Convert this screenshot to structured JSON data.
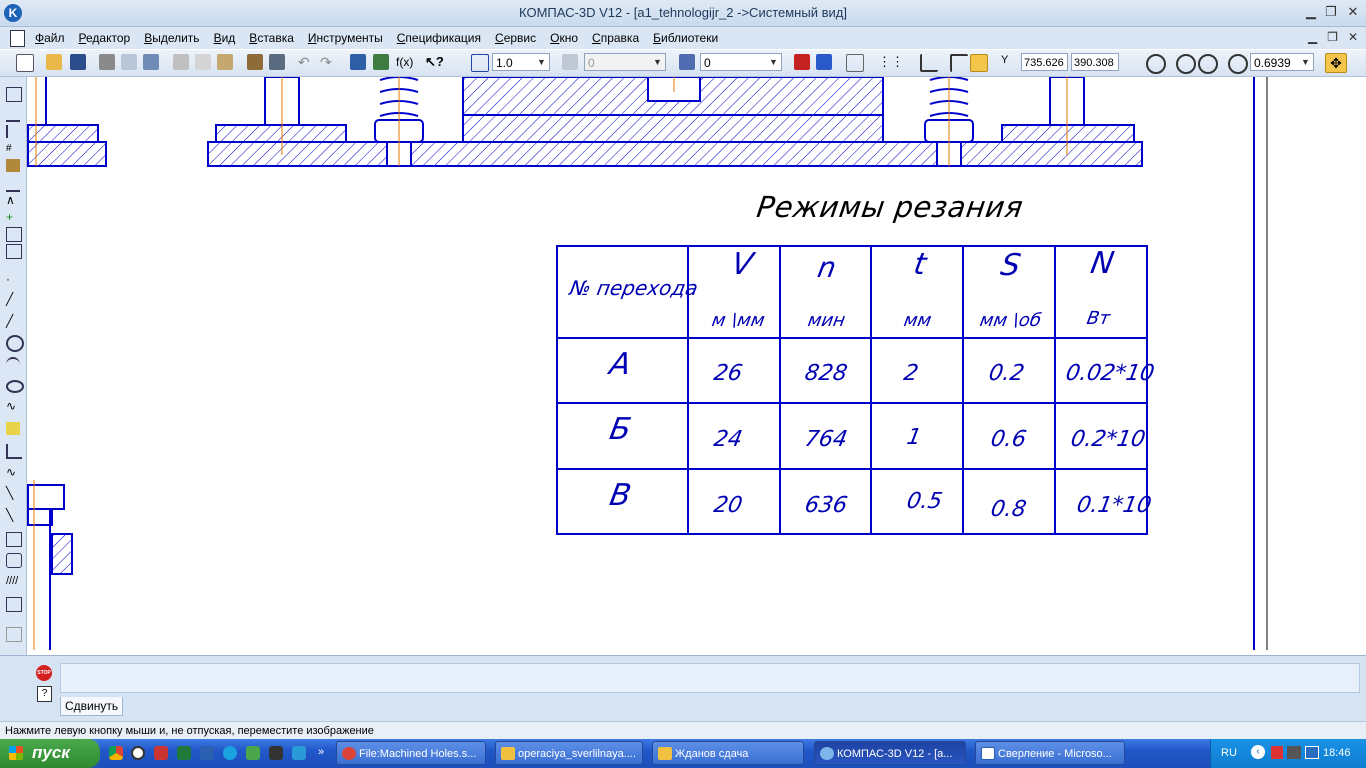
{
  "window": {
    "title": "КОМПАС-3D V12 - [a1_tehnologijr_2 ->Системный вид]"
  },
  "menu": [
    "Файл",
    "Редактор",
    "Выделить",
    "Вид",
    "Вставка",
    "Инструменты",
    "Спецификация",
    "Сервис",
    "Окно",
    "Справка",
    "Библиотеки"
  ],
  "toolbar": {
    "scale_value": "1.0",
    "style_value": "0",
    "layer_value": "0",
    "coord_label": "Y",
    "x_value": "735.626",
    "y_value": "390.308",
    "zoom_value": "0.6939",
    "fx_label": "f(x)"
  },
  "drawing": {
    "title": "Режимы резания",
    "table": {
      "headers": [
        {
          "symbol": "№ перехода",
          "unit": ""
        },
        {
          "symbol": "V",
          "unit": "м \\мм"
        },
        {
          "symbol": "n",
          "unit": "мин"
        },
        {
          "symbol": "t",
          "unit": "мм"
        },
        {
          "symbol": "S",
          "unit": "мм \\об"
        },
        {
          "symbol": "N",
          "unit": "Вт"
        }
      ],
      "rows": [
        {
          "id": "А",
          "V": "26",
          "n": "828",
          "t": "2",
          "S": "0.2",
          "N": "0.02*10"
        },
        {
          "id": "Б",
          "V": "24",
          "n": "764",
          "t": "1",
          "S": "0.6",
          "N": "0.2*10"
        },
        {
          "id": "В",
          "V": "20",
          "n": "636",
          "t": "0.5",
          "S": "0.8",
          "N": "0.1*10"
        }
      ]
    }
  },
  "panel": {
    "tab_label": "Сдвинуть",
    "stop_label": "STOP",
    "help_label": "?"
  },
  "status": "Нажмите левую кнопку мыши и, не отпуская, переместите изображение",
  "taskbar": {
    "start_label": "пуск",
    "tasks": [
      "File:Machined Holes.s...",
      "operaciya_sverlilnaya....",
      "Жданов сдача",
      "КОМПАС-3D V12 - [a...",
      "Сверление - Microso..."
    ],
    "lang": "RU",
    "clock": "18:46"
  },
  "colors": {
    "drawing_line": "#0000cc",
    "axis_line": "#e07a00",
    "accent": "#2157c9"
  }
}
